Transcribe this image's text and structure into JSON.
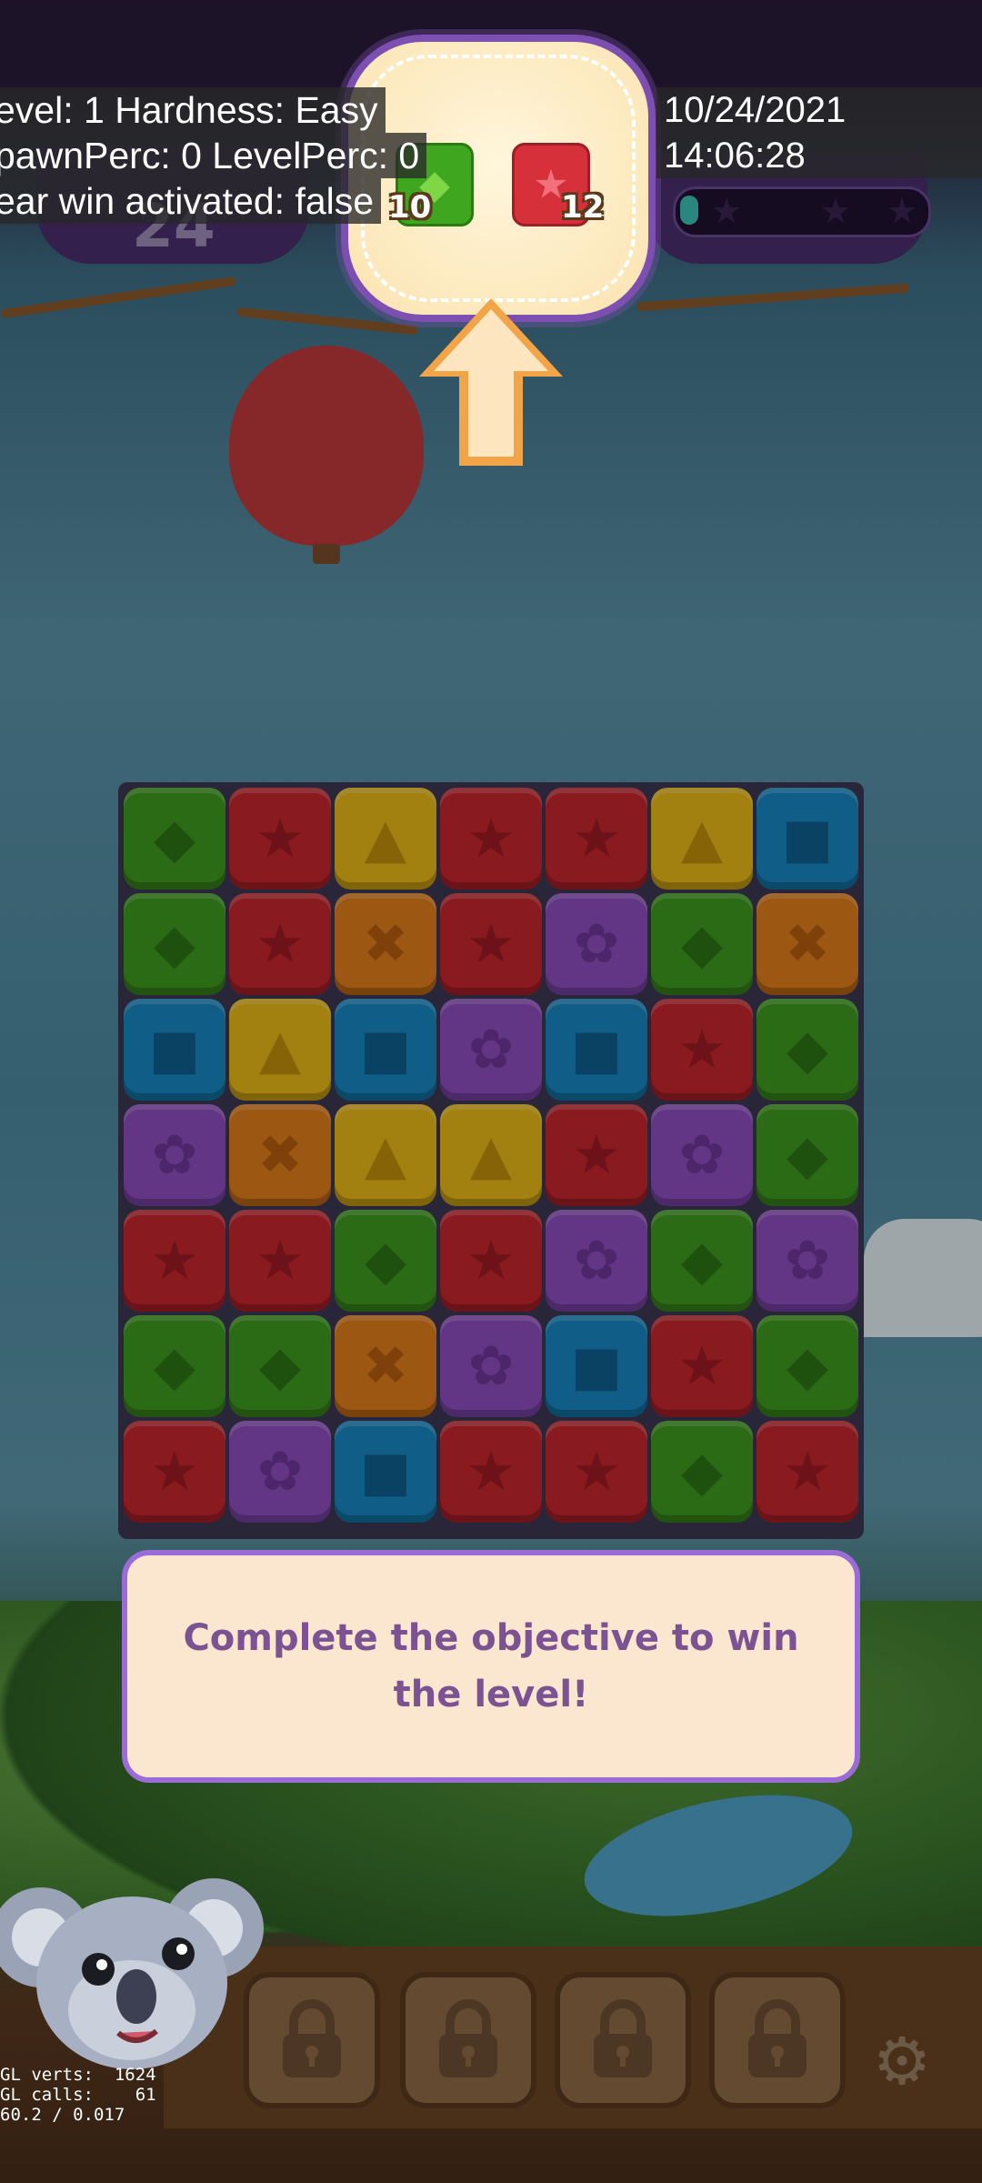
{
  "debug": {
    "level_line": "evel: 1 Hardness: Easy",
    "spawn_line": "pawnPerc: 0 LevelPerc: 0",
    "clear_line": "ear win activated: false",
    "datetime": "10/24/2021 14:06:28",
    "gl_verts_label": "GL verts:",
    "gl_verts_value": "1624",
    "gl_calls_label": "GL calls:",
    "gl_calls_value": "61",
    "fps": "60.2 / 0.017"
  },
  "hud": {
    "moves": "24",
    "score_progress": 0.05
  },
  "objective": {
    "goals": [
      {
        "color": "green",
        "shape": "diamond",
        "count": "10"
      },
      {
        "color": "red",
        "shape": "star",
        "count": "12"
      }
    ]
  },
  "board": {
    "rows": [
      [
        "green",
        "red",
        "yellow",
        "red",
        "red",
        "yellow",
        "blue"
      ],
      [
        "green",
        "red",
        "orange",
        "red",
        "purple",
        "green",
        "orange"
      ],
      [
        "blue",
        "yellow",
        "blue",
        "purple",
        "blue",
        "red",
        "green"
      ],
      [
        "purple",
        "orange",
        "yellow",
        "yellow",
        "red",
        "purple",
        "green"
      ],
      [
        "red",
        "red",
        "green",
        "red",
        "purple",
        "green",
        "purple"
      ],
      [
        "green",
        "green",
        "orange",
        "purple",
        "blue",
        "red",
        "green"
      ],
      [
        "red",
        "purple",
        "blue",
        "red",
        "red",
        "green",
        "red"
      ]
    ]
  },
  "tutorial": {
    "message": "Complete the objective to win the level!"
  },
  "boosters": {
    "slots": [
      "locked",
      "locked",
      "locked",
      "locked"
    ]
  },
  "colors": {
    "green": "#3f9a1f",
    "red": "#c4262f",
    "yellow": "#e9b918",
    "orange": "#e07d1c",
    "blue": "#1787c2",
    "purple": "#8e4dbf",
    "panel_border": "#9b6bd6",
    "tutorial_text": "#7b5392"
  },
  "icons": {
    "green": "diamond-icon",
    "red": "star-icon",
    "yellow": "triangle-icon",
    "orange": "cross-icon",
    "blue": "square-icon",
    "purple": "flower-icon",
    "booster": "lock-icon",
    "settings": "gear-icon"
  }
}
